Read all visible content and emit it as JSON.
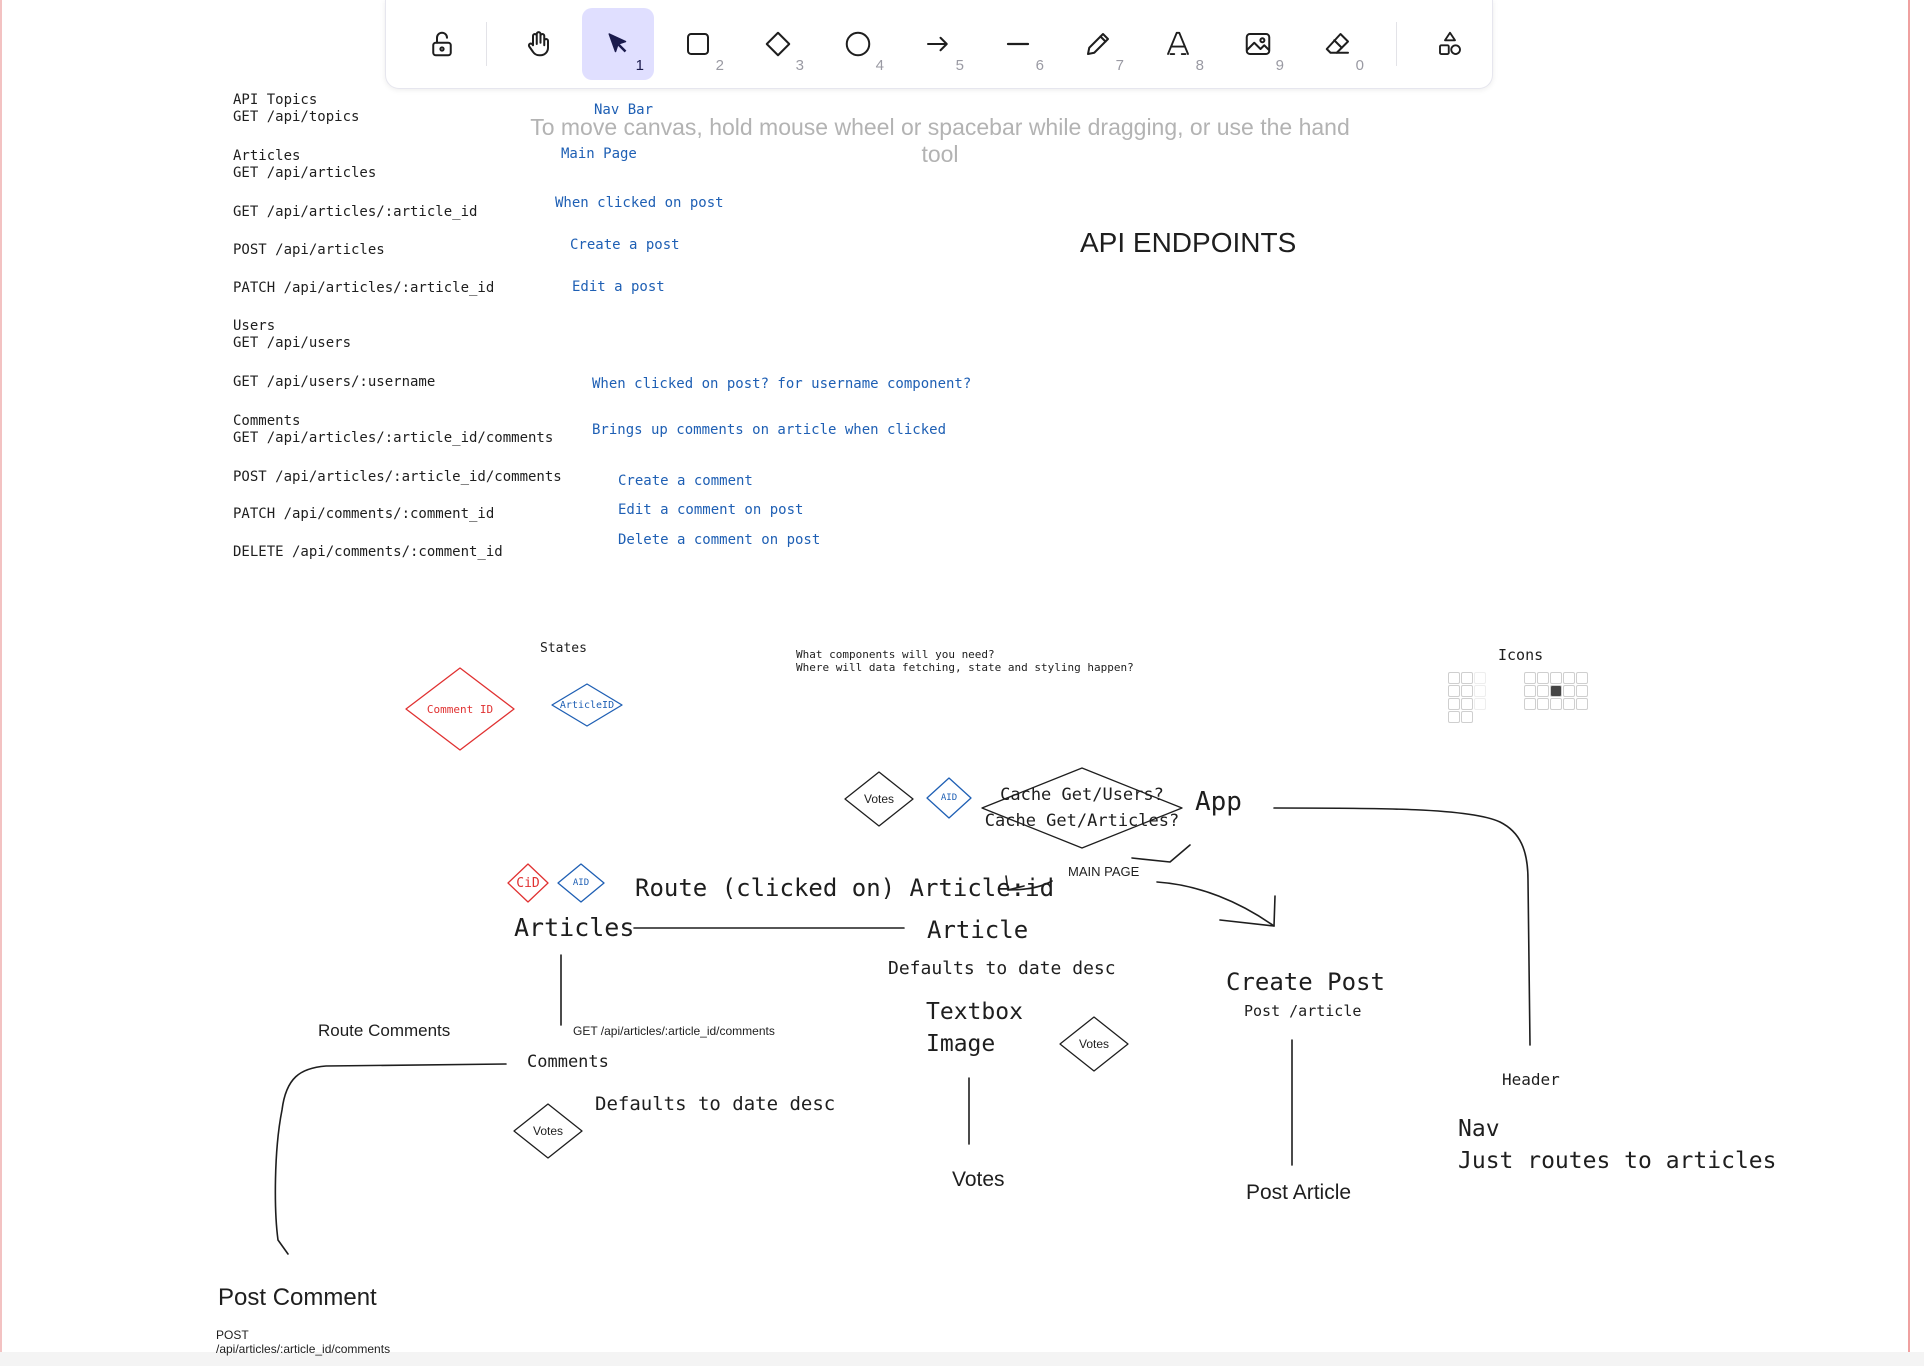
{
  "toolbar": {
    "tools": [
      {
        "name": "lock-icon",
        "shortcut": ""
      },
      {
        "name": "hand-icon",
        "shortcut": ""
      },
      {
        "name": "selection-icon",
        "shortcut": "1",
        "active": true
      },
      {
        "name": "rectangle-icon",
        "shortcut": "2"
      },
      {
        "name": "diamond-icon",
        "shortcut": "3"
      },
      {
        "name": "ellipse-icon",
        "shortcut": "4"
      },
      {
        "name": "arrow-icon",
        "shortcut": "5"
      },
      {
        "name": "line-icon",
        "shortcut": "6"
      },
      {
        "name": "pencil-icon",
        "shortcut": "7"
      },
      {
        "name": "text-icon",
        "shortcut": "8"
      },
      {
        "name": "image-icon",
        "shortcut": "9"
      },
      {
        "name": "eraser-icon",
        "shortcut": "0"
      },
      {
        "name": "more-shapes-icon",
        "shortcut": ""
      }
    ],
    "accent_active_bg": "#e0dfff"
  },
  "hint": "To move canvas, hold mouse wheel or spacebar while dragging, or use the hand tool",
  "endpoints": {
    "heading": "API ENDPOINTS",
    "list": [
      {
        "text": "API Topics\nGET /api/topics"
      },
      {
        "text": "Articles\nGET /api/articles"
      },
      {
        "text": "GET /api/articles/:article_id"
      },
      {
        "text": "POST /api/articles"
      },
      {
        "text": "PATCH /api/articles/:article_id"
      },
      {
        "text": "Users\nGET /api/users"
      },
      {
        "text": "GET /api/users/:username"
      },
      {
        "text": "Comments\nGET /api/articles/:article_id/comments"
      },
      {
        "text": "POST /api/articles/:article_id/comments"
      },
      {
        "text": "PATCH /api/comments/:comment_id"
      },
      {
        "text": "DELETE /api/comments/:comment_id"
      }
    ],
    "notes": [
      "Nav Bar",
      "Main Page",
      "When clicked on post",
      "Create a post",
      "Edit a post",
      "When clicked on post? for username component?",
      "Brings up comments on article when clicked",
      "Create a comment",
      "Edit a comment on post",
      "Delete a comment on post"
    ]
  },
  "states": {
    "label": "States",
    "comment_id": "Comment ID",
    "article_id": "ArticleID"
  },
  "question": "What components will you need?\nWhere will data fetching, state and styling happen?",
  "icons_label": "Icons",
  "tree": {
    "votes_top": "Votes",
    "aid_top": "AID",
    "cache": "Cache Get/Users?\nCache Get/Articles?",
    "app": "App",
    "main_page": "MAIN PAGE",
    "cid": "CiD",
    "aid_articles": "AID",
    "route_article": "Route (clicked on) Article:id",
    "articles": "Articles",
    "article": "Article",
    "article_default": "Defaults to date desc",
    "textbox_image": "Textbox\nImage",
    "votes_article": "Votes",
    "votes_bottom": "Votes",
    "create_post": "Create Post",
    "post_article_endpoint": "Post /article",
    "post_article": "Post Article",
    "header": "Header",
    "nav": "Nav\nJust routes to articles",
    "route_comments": "Route Comments",
    "comments_endpoint": "GET /api/articles/:article_id/comments",
    "comments": "Comments",
    "comments_default": "Defaults to date desc",
    "votes_comments": "Votes",
    "post_comment": "Post Comment",
    "post_comment_endpoint": "POST\n/api/articles/:article_id/comments"
  },
  "colors": {
    "ink": "#1e1e1e",
    "blue": "#1e5fb4",
    "red": "#e03131",
    "hint": "#b3b3b3"
  }
}
